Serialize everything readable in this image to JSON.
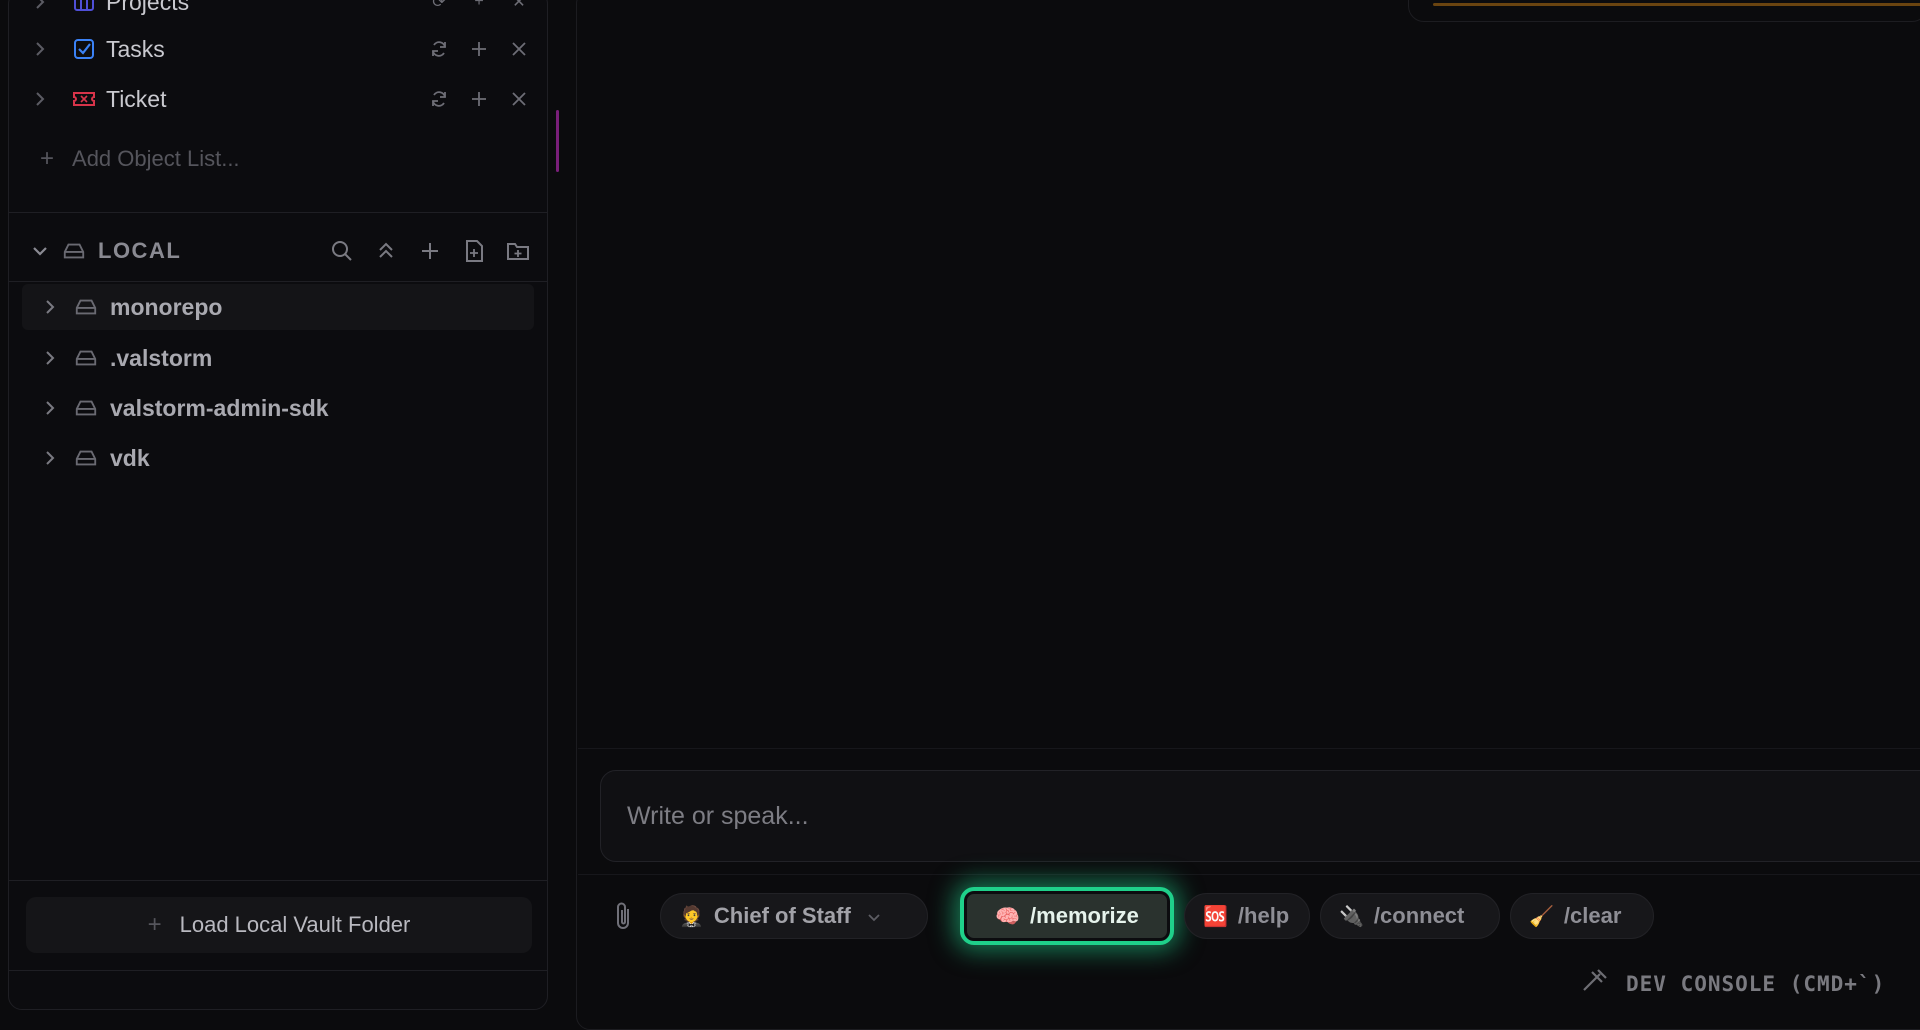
{
  "sidebar": {
    "object_lists": [
      {
        "label": "Projects",
        "icon": "board-icon",
        "color": "#4f4fd8"
      },
      {
        "label": "Tasks",
        "icon": "checkbox-icon",
        "color": "#3b82f6"
      },
      {
        "label": "Ticket",
        "icon": "ticket-icon",
        "color": "#d8344a"
      }
    ],
    "add_object_list_label": "Add Object List...",
    "local": {
      "title": "LOCAL",
      "folders": [
        {
          "label": "monorepo",
          "active": true
        },
        {
          "label": ".valstorm"
        },
        {
          "label": "valstorm-admin-sdk"
        },
        {
          "label": "vdk"
        }
      ]
    },
    "load_vault_label": "Load Local Vault Folder"
  },
  "composer": {
    "placeholder": "Write or speak...",
    "agent": {
      "emoji": "🤵",
      "label": "Chief of Staff"
    },
    "commands": [
      {
        "emoji": "🧠",
        "label": "/memorize",
        "highlighted": true
      },
      {
        "emoji": "🆘",
        "label": "/help"
      },
      {
        "emoji": "🔌",
        "label": "/connect"
      },
      {
        "emoji": "🧹",
        "label": "/clear"
      }
    ]
  },
  "footer": {
    "dev_console_label": "DEV CONSOLE (CMD+`)"
  },
  "colors": {
    "accent_glow": "#1fd08a",
    "background": "#0b0b0d",
    "top_card_bar": "#6a4410"
  }
}
